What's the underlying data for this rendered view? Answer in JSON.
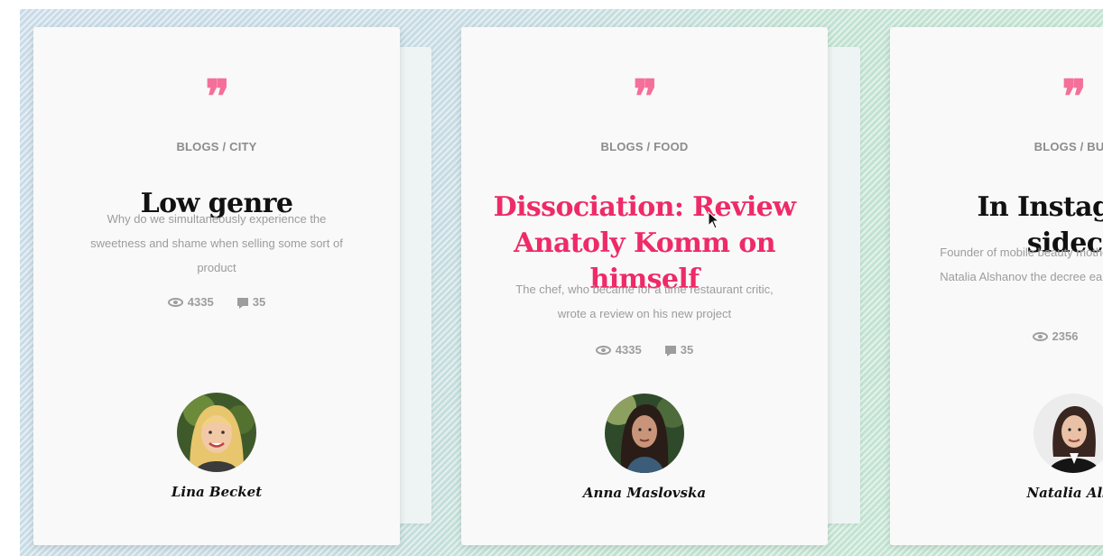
{
  "colors": {
    "accent_pink": "#ee2a67",
    "quote_pink": "#f56f9b",
    "title_dark": "#111111"
  },
  "cards": [
    {
      "quote_icon": "quote-icon",
      "category": "BLOGS / CITY",
      "title": "Low genre",
      "excerpt": "Why do we simultaneously experience the sweetness and shame when selling some sort of product",
      "views": "4335",
      "comments": "35",
      "author": "Lina Becket"
    },
    {
      "quote_icon": "quote-icon",
      "category": "BLOGS / FOOD",
      "title": "Dissociation: Review Anatoly Komm on himself",
      "excerpt": "The chef, who became for a time  restaurant critic, wrote a review on his new project",
      "views": "4335",
      "comments": "35",
      "author": "Anna Maslovska"
    },
    {
      "quote_icon": "quote-icon",
      "category": "BLOGS / BUS",
      "title": "In Instagram sideca",
      "excerpt": "Founder of mobile beauty mother Natalia  Alshanov the decree earn",
      "views": "2356",
      "author": "Natalia Alsh"
    }
  ]
}
